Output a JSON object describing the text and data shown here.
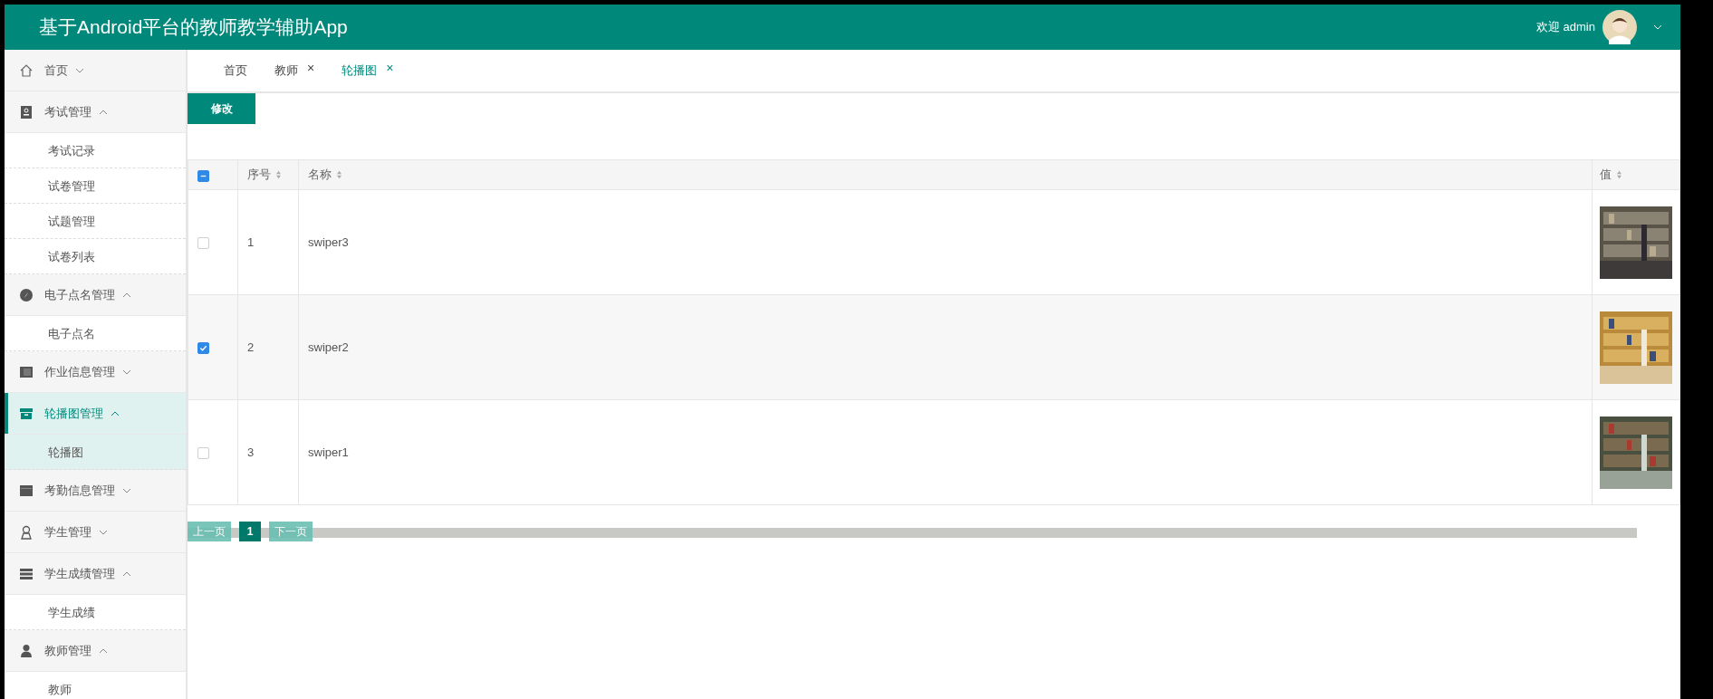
{
  "header": {
    "title": "基于Android平台的教师教学辅助App",
    "welcome": "欢迎 admin"
  },
  "sidebar": {
    "items": [
      {
        "label": "首页",
        "expanded": false,
        "selected": false
      },
      {
        "label": "考试管理",
        "expanded": true,
        "selected": false,
        "children": [
          {
            "label": "考试记录",
            "selected": false
          },
          {
            "label": "试卷管理",
            "selected": false
          },
          {
            "label": "试题管理",
            "selected": false
          },
          {
            "label": "试卷列表",
            "selected": false
          }
        ]
      },
      {
        "label": "电子点名管理",
        "expanded": true,
        "selected": false,
        "children": [
          {
            "label": "电子点名",
            "selected": false
          }
        ]
      },
      {
        "label": "作业信息管理",
        "expanded": false,
        "selected": false
      },
      {
        "label": "轮播图管理",
        "expanded": true,
        "selected": true,
        "children": [
          {
            "label": "轮播图",
            "selected": true
          }
        ]
      },
      {
        "label": "考勤信息管理",
        "expanded": false,
        "selected": false
      },
      {
        "label": "学生管理",
        "expanded": false,
        "selected": false
      },
      {
        "label": "学生成绩管理",
        "expanded": true,
        "selected": false,
        "children": [
          {
            "label": "学生成绩",
            "selected": false
          }
        ]
      },
      {
        "label": "教师管理",
        "expanded": true,
        "selected": false,
        "children": [
          {
            "label": "教师",
            "selected": false
          }
        ]
      }
    ]
  },
  "tabs": [
    {
      "label": "首页",
      "selected": false
    },
    {
      "label": "教师",
      "selected": false,
      "close": "×"
    },
    {
      "label": "轮播图",
      "selected": true,
      "close": "×"
    }
  ],
  "toolbar": {
    "edit_button": "修改"
  },
  "table": {
    "select_all": {
      "indeterminate": true
    },
    "columns": [
      "序号",
      "名称",
      "值"
    ],
    "rows": [
      {
        "checked": false,
        "index": "1",
        "name": "swiper3"
      },
      {
        "checked": true,
        "index": "2",
        "name": "swiper2"
      },
      {
        "checked": false,
        "index": "3",
        "name": "swiper1"
      }
    ]
  },
  "pagination": {
    "prev": "上一页",
    "pages": [
      {
        "label": "1",
        "selected": true
      }
    ],
    "next": "下一页"
  }
}
